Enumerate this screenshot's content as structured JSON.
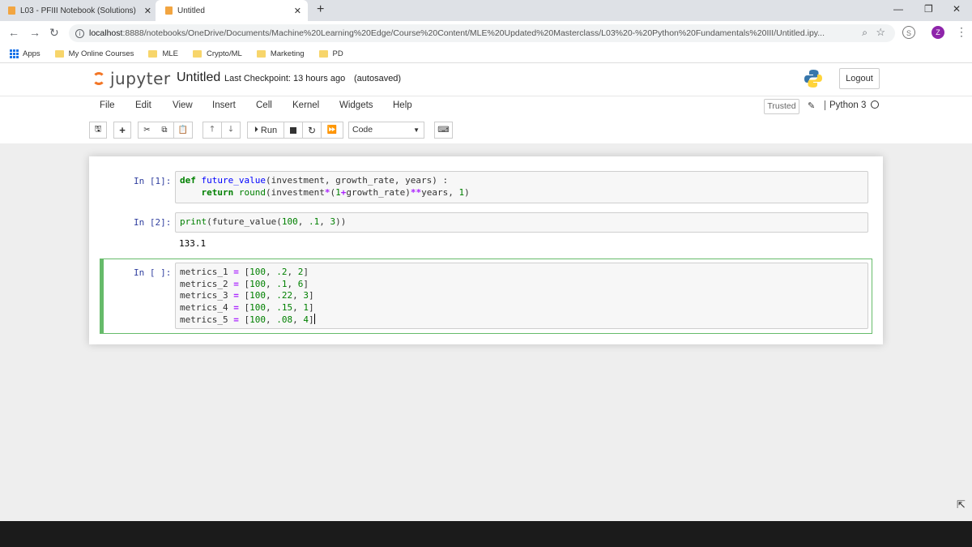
{
  "browser": {
    "tabs": [
      {
        "title": "L03 - PFIII Notebook (Solutions)",
        "close": "✕"
      },
      {
        "title": "Untitled",
        "close": "✕"
      }
    ],
    "new_tab": "+",
    "window_controls": [
      "—",
      "❐",
      "✕"
    ],
    "address": {
      "host": "localhost",
      "path": ":8888/notebooks/OneDrive/Documents/Machine%20Learning%20Edge/Course%20Content/MLE%20Updated%20Masterclass/L03%20-%20Python%20Fundamentals%20III/Untitled.ipy..."
    },
    "profile_initial": "Z",
    "bookmarks": [
      "Apps",
      "My Online Courses",
      "MLE",
      "Crypto/ML",
      "Marketing",
      "PD"
    ]
  },
  "jupyter": {
    "logo_text": "jupyter",
    "notebook_name": "Untitled",
    "checkpoint": "Last Checkpoint: 13 hours ago",
    "autosave": "(autosaved)",
    "logout": "Logout",
    "menu": [
      "File",
      "Edit",
      "View",
      "Insert",
      "Cell",
      "Kernel",
      "Widgets",
      "Help"
    ],
    "trusted": "Trusted",
    "kernel_name": "Python 3",
    "toolbar": {
      "run_label": "Run",
      "cell_type": "Code"
    }
  },
  "cells": [
    {
      "prompt": "In [1]:"
    },
    {
      "prompt": "In [2]:",
      "output": "133.1"
    },
    {
      "prompt": "In [ ]:"
    }
  ]
}
